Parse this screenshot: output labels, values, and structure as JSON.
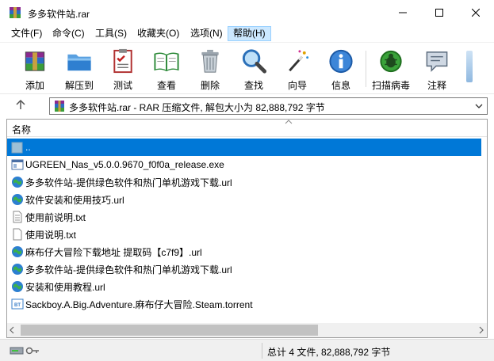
{
  "window": {
    "title": "多多软件站.rar",
    "controls": [
      "minimize",
      "maximize",
      "close"
    ]
  },
  "menu": {
    "items": [
      {
        "label": "文件(F)"
      },
      {
        "label": "命令(C)"
      },
      {
        "label": "工具(S)"
      },
      {
        "label": "收藏夹(O)"
      },
      {
        "label": "选项(N)"
      },
      {
        "label": "帮助(H)",
        "active": true
      }
    ]
  },
  "toolbar": {
    "buttons": [
      {
        "label": "添加",
        "icon": "add-archive-icon"
      },
      {
        "label": "解压到",
        "icon": "extract-folder-icon"
      },
      {
        "label": "测试",
        "icon": "test-checklist-icon"
      },
      {
        "label": "查看",
        "icon": "view-book-icon"
      },
      {
        "label": "删除",
        "icon": "trash-icon"
      },
      {
        "label": "查找",
        "icon": "magnifier-icon"
      },
      {
        "label": "向导",
        "icon": "wizard-wand-icon"
      },
      {
        "label": "信息",
        "icon": "info-icon"
      },
      {
        "label": "扫描病毒",
        "icon": "virus-scan-icon"
      },
      {
        "label": "注释",
        "icon": "comment-icon"
      }
    ]
  },
  "address": {
    "text": "多多软件站.rar - RAR 压缩文件, 解包大小为 82,888,792 字节"
  },
  "filelist": {
    "column_name": "名称",
    "rows": [
      {
        "name": "..",
        "type": "parent",
        "selected": true
      },
      {
        "name": "UGREEN_Nas_v5.0.0.9670_f0f0a_release.exe",
        "type": "exe"
      },
      {
        "name": "多多软件站-提供绿色软件和热门单机游戏下载.url",
        "type": "url"
      },
      {
        "name": "软件安装和使用技巧.url",
        "type": "url"
      },
      {
        "name": "使用前说明.txt",
        "type": "txt"
      },
      {
        "name": "使用说明.txt",
        "type": "txt"
      },
      {
        "name": "麻布仔大冒险下载地址 提取码【c7f9】.url",
        "type": "url"
      },
      {
        "name": "多多软件站-提供绿色软件和热门单机游戏下载.url",
        "type": "url"
      },
      {
        "name": "安装和使用教程.url",
        "type": "url"
      },
      {
        "name": "Sackboy.A.Big.Adventure.麻布仔大冒险.Steam.torrent",
        "type": "torrent"
      }
    ]
  },
  "status": {
    "summary": "总计 4 文件, 82,888,792 字节"
  },
  "colors": {
    "selection": "#0078d7",
    "menu_active": "#cce8ff"
  }
}
